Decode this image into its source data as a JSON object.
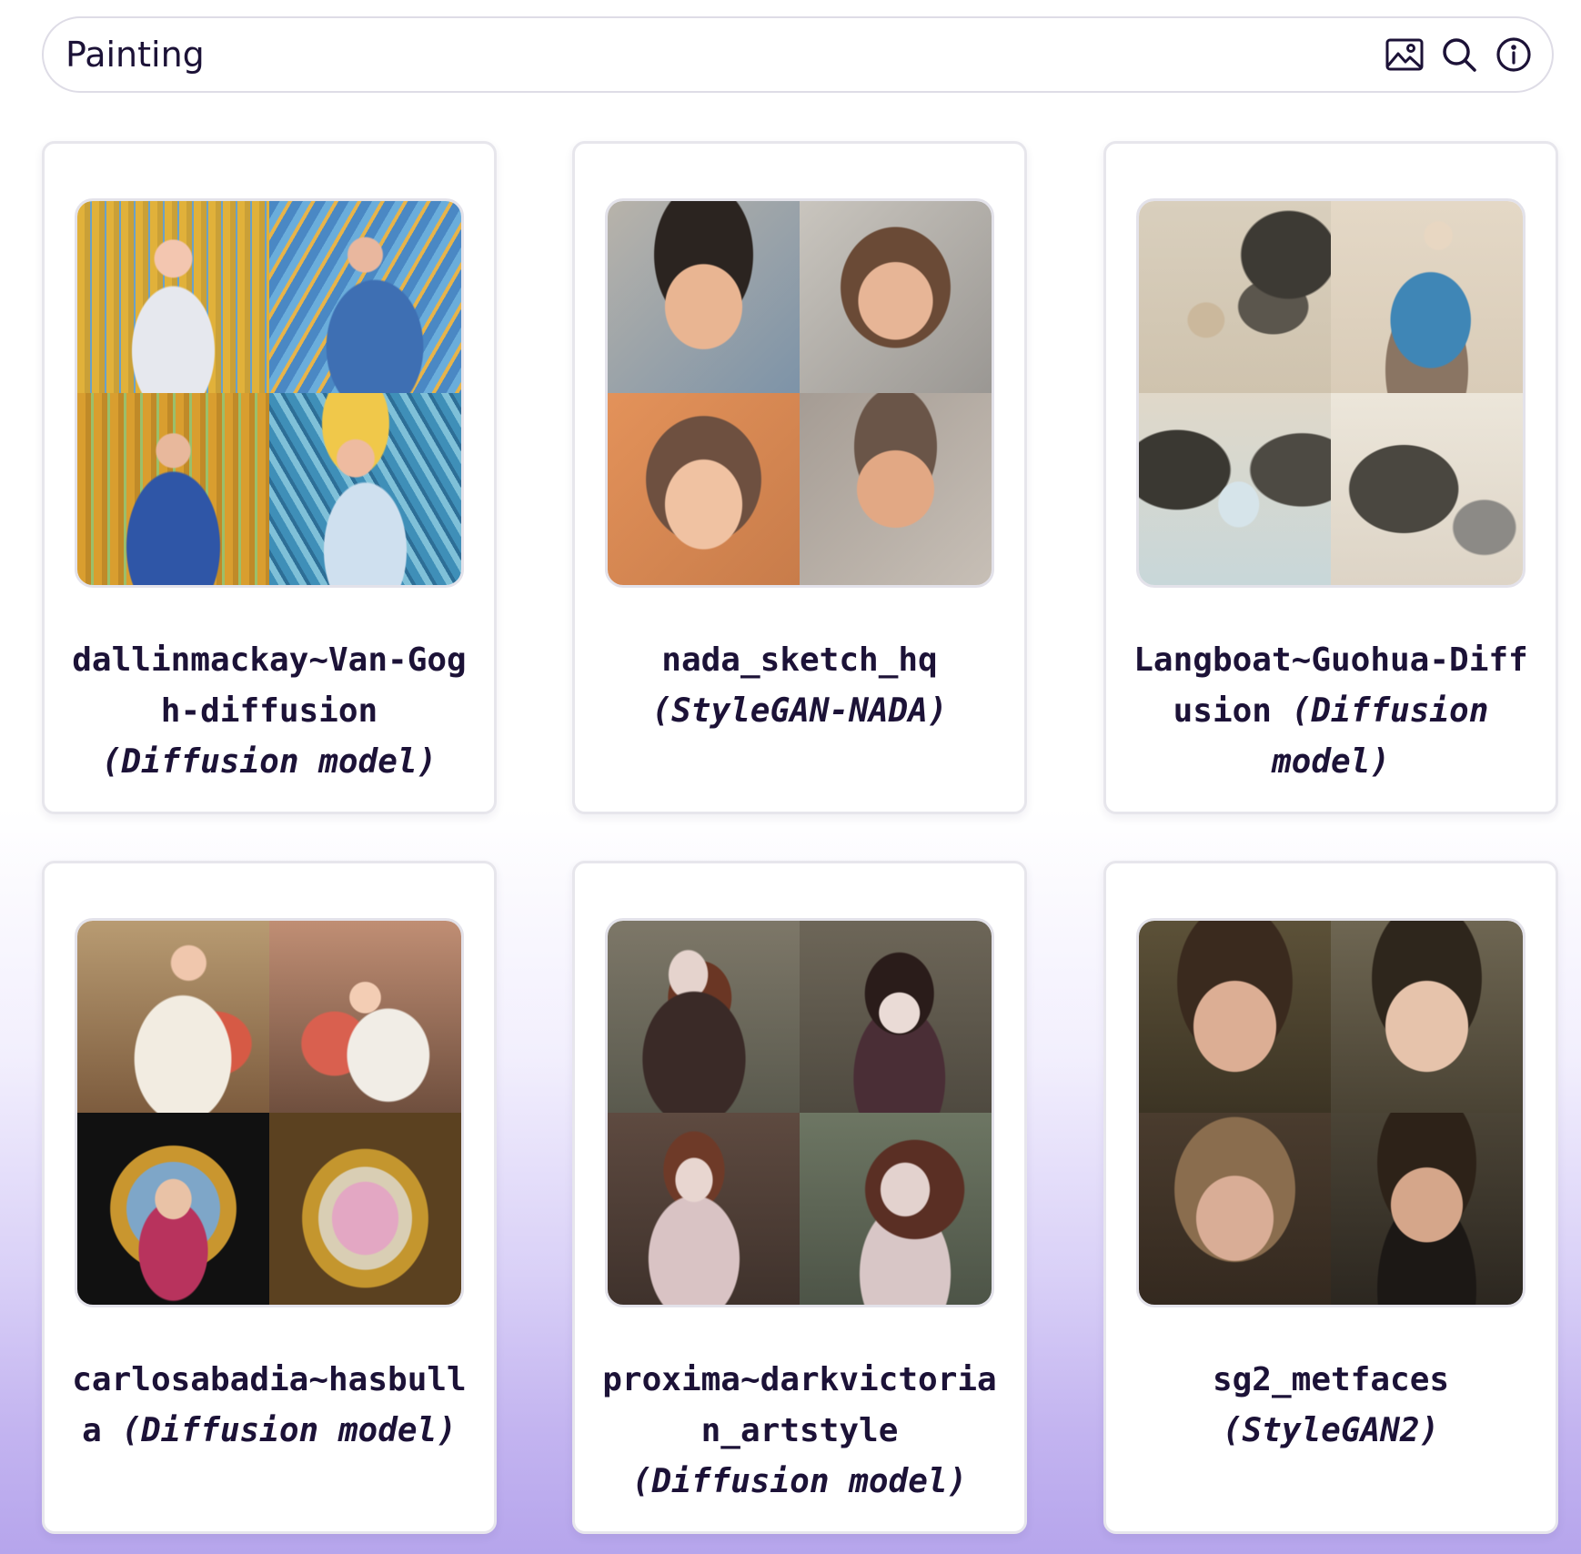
{
  "search": {
    "value": "Painting",
    "icons": [
      "image-search-icon",
      "search-icon",
      "info-icon"
    ]
  },
  "colors": {
    "text": "#1c1237",
    "card_border": "#e7e6ec",
    "gradient_bottom": "#b6a5ec"
  },
  "cards": [
    {
      "name": "dallinmackay~Van-Gogh-diffusion",
      "type": "(Diffusion model)"
    },
    {
      "name": "nada_sketch_hq",
      "type": "(StyleGAN-NADA)"
    },
    {
      "name": "Langboat~Guohua-Diffusion",
      "type": "(Diffusion model)"
    },
    {
      "name": "carlosabadia~hasbulla",
      "type": "(Diffusion model)"
    },
    {
      "name": "proxima~darkvictorian_artstyle",
      "type": "(Diffusion model)"
    },
    {
      "name": "sg2_metfaces",
      "type": "(StyleGAN2)"
    }
  ]
}
